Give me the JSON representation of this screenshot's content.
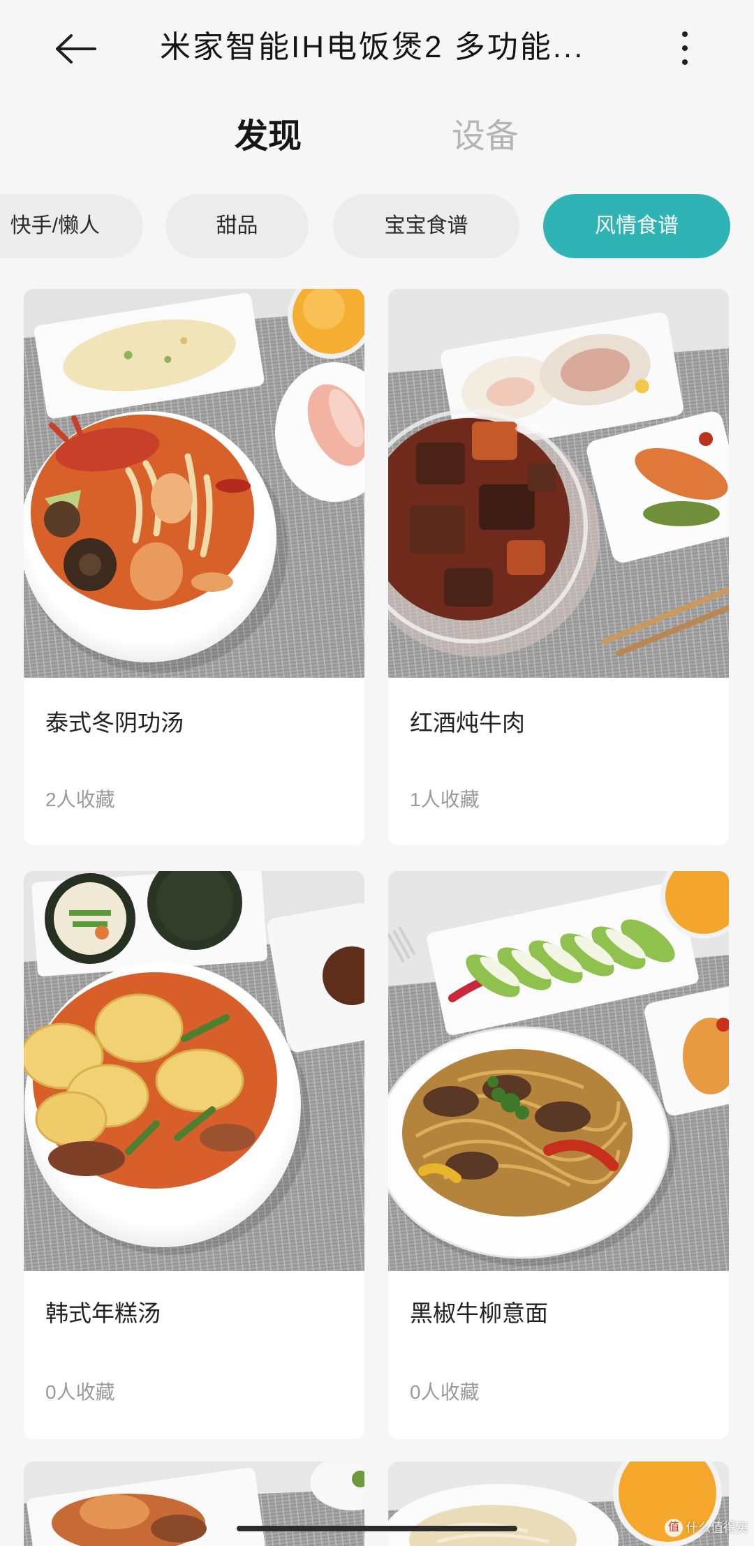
{
  "header": {
    "back_icon": "arrow-left-icon",
    "title": "米家智能IH电饭煲2 多功能...",
    "more_icon": "more-vertical-icon"
  },
  "tabs": [
    {
      "label": "发现",
      "active": true
    },
    {
      "label": "设备",
      "active": false
    }
  ],
  "categories": [
    {
      "label": "快手/懒人",
      "active": false
    },
    {
      "label": "甜品",
      "active": false
    },
    {
      "label": "宝宝食谱",
      "active": false
    },
    {
      "label": "风情食谱",
      "active": true
    }
  ],
  "recipes": [
    {
      "name": "泰式冬阴功汤",
      "favorites": "2人收藏"
    },
    {
      "name": "红酒炖牛肉",
      "favorites": "1人收藏"
    },
    {
      "name": "韩式年糕汤",
      "favorites": "0人收藏"
    },
    {
      "name": "黑椒牛柳意面",
      "favorites": "0人收藏"
    }
  ],
  "colors": {
    "accent": "#2fb3b5",
    "chip_bg": "#ececec",
    "page_bg": "#f6f6f6"
  },
  "watermark": {
    "logo_char": "值",
    "text": "什么值得买"
  }
}
